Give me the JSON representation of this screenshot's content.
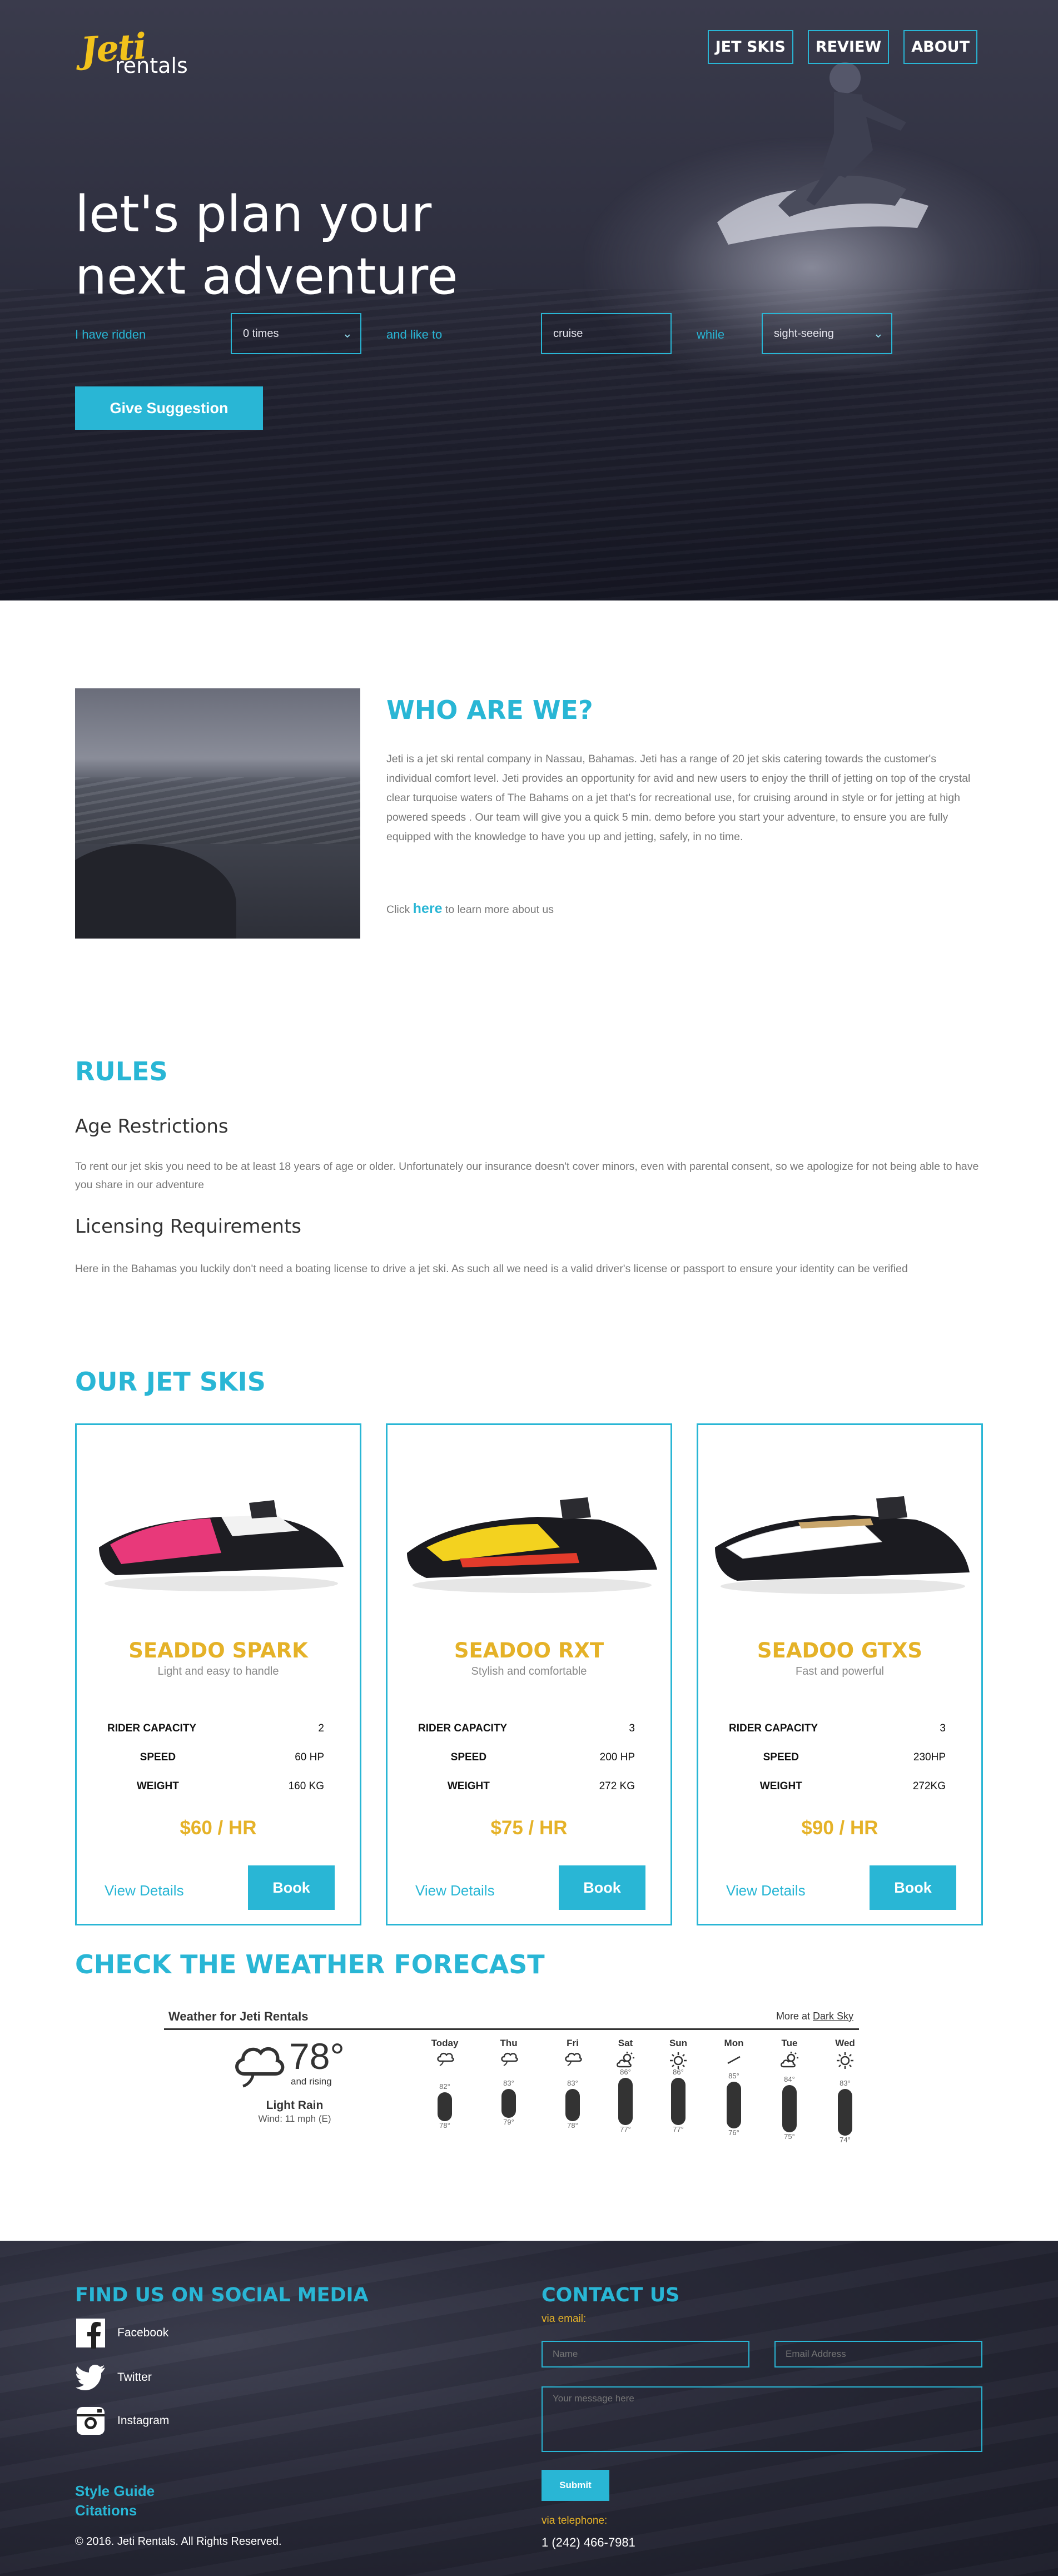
{
  "brand": {
    "logo_script": "Jeti",
    "logo_word": "rentals"
  },
  "nav": {
    "items": [
      "JET SKIS",
      "REVIEW",
      "ABOUT"
    ]
  },
  "hero": {
    "headline_line1": "let's plan your",
    "headline_line2": "next adventure",
    "label_ridden": "I have ridden",
    "select_times": "0 times",
    "label_like": "and like to",
    "select_activity": "cruise",
    "label_while": "while",
    "select_while": "sight-seeing",
    "cta": "Give Suggestion"
  },
  "about": {
    "title": "WHO ARE WE?",
    "body": "Jeti is a jet ski rental company in Nassau, Bahamas. Jeti has a range of 20 jet skis catering towards the customer's individual comfort level. Jeti provides an opportunity for avid and new users to enjoy the thrill of jetting on top of the crystal clear turquoise waters of The Bahams on a jet that's for recreational use, for cruising around in style or for jetting at high powered speeds . Our team will give you a quick 5 min. demo before you start your adventure, to ensure you are fully equipped with the knowledge to have you up and jetting, safely, in no time.",
    "more_prefix": "Click",
    "more_link": "here",
    "more_suffix": "to learn more about us"
  },
  "rules": {
    "title": "RULES",
    "age_title": "Age Restrictions",
    "age_body": "To rent our jet skis you need to be at least 18 years of age or older. Unfortunately our insurance doesn't cover minors, even with parental consent, so we apologize for not being able to have you share in our adventure",
    "license_title": "Licensing Requirements",
    "license_body": "Here in the Bahamas you luckily don't need a boating license to drive a jet ski. As such all we need is a valid driver's license or passport to ensure your identity can be verified"
  },
  "skis": {
    "title": "OUR JET SKIS",
    "cards": [
      {
        "name": "SEADDO SPARK",
        "tagline": "Light and easy to handle",
        "capacity_label": "RIDER CAPACITY",
        "capacity": "2",
        "speed_label": "SPEED",
        "speed": "60 HP",
        "weight_label": "WEIGHT",
        "weight": "160 KG",
        "price": "$60 / HR",
        "details": "View Details",
        "book": "Book",
        "accent": "#e8397a"
      },
      {
        "name": "SEADOO RXT",
        "tagline": "Stylish and comfortable",
        "capacity_label": "RIDER CAPACITY",
        "capacity": "3",
        "speed_label": "SPEED",
        "speed": "200 HP",
        "weight_label": "WEIGHT",
        "weight": "272 KG",
        "price": "$75 / HR",
        "details": "View Details",
        "book": "Book",
        "accent": "#f3d21f"
      },
      {
        "name": "SEADOO GTXS",
        "tagline": "Fast and powerful",
        "capacity_label": "RIDER CAPACITY",
        "capacity": "3",
        "speed_label": "SPEED",
        "speed": "230HP",
        "weight_label": "WEIGHT",
        "weight": "272KG",
        "price": "$90 / HR",
        "details": "View Details",
        "book": "Book",
        "accent": "#ffffff"
      }
    ]
  },
  "weather": {
    "title": "CHECK THE WEATHER FORECAST",
    "widget_title": "Weather for Jeti Rentals",
    "more_prefix": "More at",
    "more_link": "Dark Sky",
    "current_temp": "78°",
    "trend": "and rising",
    "condition": "Light Rain",
    "wind": "Wind: 11 mph (E)",
    "days": [
      {
        "name": "Today",
        "hi": "82°",
        "lo": "78°",
        "icon": "rain-icon"
      },
      {
        "name": "Thu",
        "hi": "83°",
        "lo": "79°",
        "icon": "rain-icon"
      },
      {
        "name": "Fri",
        "hi": "83°",
        "lo": "78°",
        "icon": "rain-icon"
      },
      {
        "name": "Sat",
        "hi": "86°",
        "lo": "77°",
        "icon": "partly-sunny-icon"
      },
      {
        "name": "Sun",
        "hi": "86°",
        "lo": "77°",
        "icon": "sun-icon"
      },
      {
        "name": "Mon",
        "hi": "85°",
        "lo": "76°",
        "icon": "wind-icon"
      },
      {
        "name": "Tue",
        "hi": "84°",
        "lo": "75°",
        "icon": "partly-sunny-icon"
      },
      {
        "name": "Wed",
        "hi": "83°",
        "lo": "74°",
        "icon": "sun-icon"
      }
    ]
  },
  "footer": {
    "social_title": "FIND US ON SOCIAL MEDIA",
    "facebook": "Facebook",
    "twitter": "Twitter",
    "instagram": "Instagram",
    "style_guide": "Style Guide",
    "citations": "Citations",
    "copyright": "© 2016. Jeti Rentals. All Rights Reserved.",
    "contact_title": "CONTACT US",
    "via_email": "via email:",
    "name_placeholder": "Name",
    "email_placeholder": "Email Address",
    "message_placeholder": "Your message here",
    "submit": "Submit",
    "via_phone": "via telephone:",
    "phone": "1 (242) 466-7981"
  },
  "colors": {
    "accent": "#29b6d5",
    "gold": "#e5b228",
    "hero_dark": "#2a2b3a"
  }
}
